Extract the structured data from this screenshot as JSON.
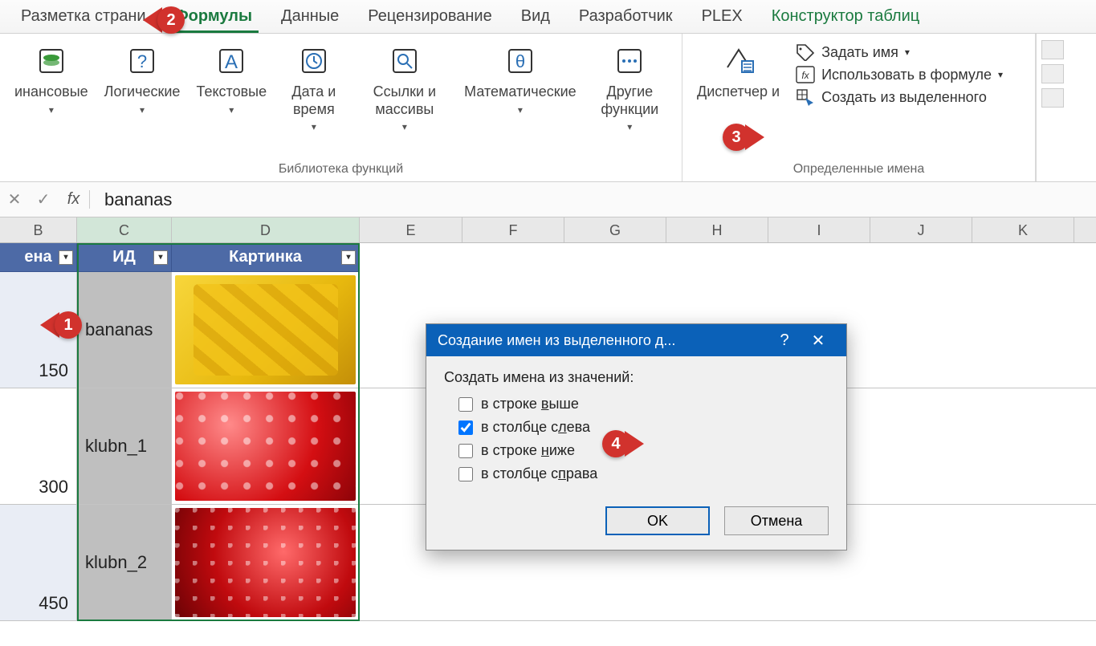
{
  "ribbon_tabs": {
    "page_layout": "Разметка страни",
    "formulas": "Формулы",
    "data": "Данные",
    "review": "Рецензирование",
    "view": "Вид",
    "developer": "Разработчик",
    "plex": "PLEX",
    "constructor": "Конструктор таблиц"
  },
  "library": {
    "financial": "инансовые",
    "logical": "Логические",
    "text": "Текстовые",
    "datetime": "Дата и время",
    "lookup": "Ссылки и массивы",
    "math": "Математические",
    "more": "Другие функции",
    "group_label": "Библиотека функций"
  },
  "names": {
    "manager": "Диспетчер и",
    "define": "Задать имя",
    "use": "Использовать в формуле",
    "create": "Создать из выделенного",
    "group_label": "Определенные имена"
  },
  "formula_bar": {
    "fx": "fx",
    "value": "bananas"
  },
  "columns": {
    "B": "B",
    "C": "C",
    "D": "D",
    "E": "E",
    "F": "F",
    "G": "G",
    "H": "H",
    "I": "I",
    "J": "J",
    "K": "K"
  },
  "table": {
    "headers": {
      "price": "ена",
      "id": "ИД",
      "pic": "Картинка"
    },
    "rows": [
      {
        "price": "150",
        "id": "bananas",
        "pic": "banana"
      },
      {
        "price": "300",
        "id": "klubn_1",
        "pic": "straw"
      },
      {
        "price": "450",
        "id": "klubn_2",
        "pic": "straw2"
      }
    ]
  },
  "dialog": {
    "title": "Создание имен из выделенного д...",
    "help": "?",
    "close": "✕",
    "prompt": "Создать имена из значений:",
    "opt_top": {
      "pre": "в строке ",
      "ul": "в",
      "post": "ыше"
    },
    "opt_left": {
      "pre": "в столбце с",
      "ul": "л",
      "post": "ева"
    },
    "opt_bottom": {
      "pre": "в строке ",
      "ul": "н",
      "post": "иже"
    },
    "opt_right": {
      "pre": "в столбце с",
      "ul": "п",
      "post": "рава"
    },
    "ok": "OK",
    "cancel": "Отмена"
  },
  "markers": {
    "m1": "1",
    "m2": "2",
    "m3": "3",
    "m4": "4"
  }
}
